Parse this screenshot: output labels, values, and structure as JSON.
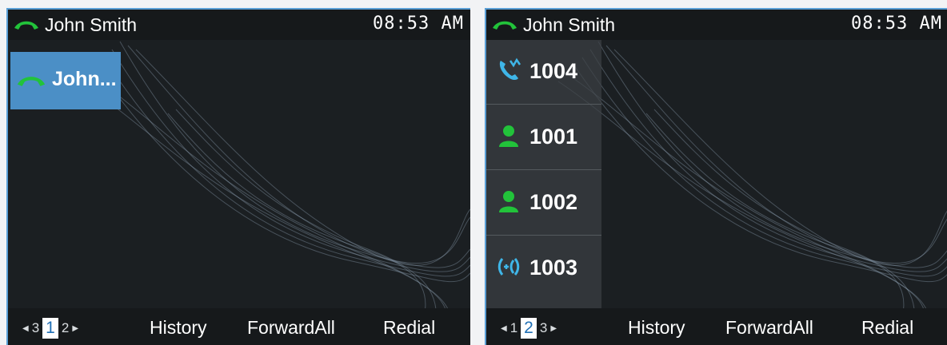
{
  "left_screen": {
    "header": {
      "account_name": "John Smith",
      "clock": "08:53 AM",
      "icon": "handset-icon"
    },
    "active_line": {
      "label": "John...",
      "icon": "handset-icon",
      "color": "#4b8fc6"
    },
    "pager": {
      "prev_page": "3",
      "current_page": "1",
      "next_page": "2"
    },
    "softkeys": {
      "history": "History",
      "forward_all": "ForwardAll",
      "redial": "Redial"
    }
  },
  "right_screen": {
    "header": {
      "account_name": "John Smith",
      "clock": "08:53 AM",
      "icon": "handset-icon"
    },
    "favorites": [
      {
        "label": "1004",
        "icon": "missed-call-icon",
        "color": "#3fb6e8"
      },
      {
        "label": "1001",
        "icon": "contact-icon",
        "color": "#22c33a"
      },
      {
        "label": "1002",
        "icon": "contact-icon",
        "color": "#22c33a"
      },
      {
        "label": "1003",
        "icon": "intercom-icon",
        "color": "#3fb6e8"
      }
    ],
    "pager": {
      "prev_page": "1",
      "current_page": "2",
      "next_page": "3"
    },
    "softkeys": {
      "history": "History",
      "forward_all": "ForwardAll",
      "redial": "Redial"
    }
  },
  "colors": {
    "handset_green": "#22c33a",
    "accent_blue": "#4b8fc6",
    "background": "#1b1f22"
  }
}
